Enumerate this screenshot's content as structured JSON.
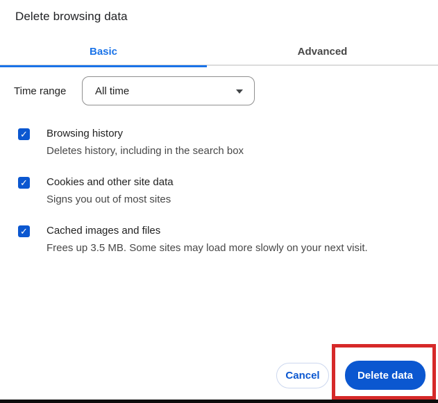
{
  "dialog": {
    "title": "Delete browsing data",
    "tabs": [
      {
        "label": "Basic",
        "active": true
      },
      {
        "label": "Advanced",
        "active": false
      }
    ],
    "time_range": {
      "label": "Time range",
      "value": "All time"
    },
    "options": [
      {
        "title": "Browsing history",
        "subtitle": "Deletes history, including in the search box",
        "checked": true
      },
      {
        "title": "Cookies and other site data",
        "subtitle": "Signs you out of most sites",
        "checked": true
      },
      {
        "title": "Cached images and files",
        "subtitle": "Frees up 3.5 MB. Some sites may load more slowly on your next visit.",
        "checked": true
      }
    ],
    "buttons": {
      "cancel": "Cancel",
      "confirm": "Delete data"
    }
  },
  "icons": {
    "checkmark": "✓"
  },
  "annotation": {
    "type": "highlight-rectangle",
    "target": "delete-data-button",
    "color": "#d62929"
  },
  "colors": {
    "tab_active_blue": "#1a73e8",
    "accent_blue": "#0b57d0",
    "title_text": "#202124",
    "body_text": "#1f1f1f",
    "secondary_text": "#474747",
    "divider_gray": "#dcdcdc",
    "annotation_red": "#d62929",
    "bottom_edge_black": "#0d0d0d"
  }
}
